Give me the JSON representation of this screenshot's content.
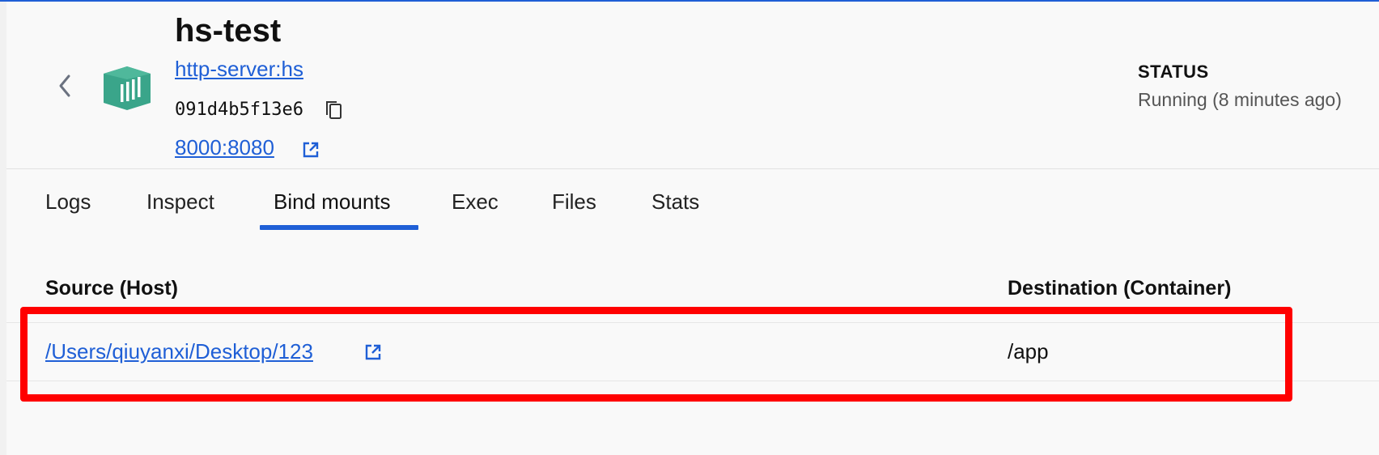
{
  "header": {
    "title": "hs-test",
    "image_link": "http-server:hs",
    "container_id": "091d4b5f13e6",
    "port_link": "8000:8080",
    "status_label": "STATUS",
    "status_value": "Running (8 minutes ago)"
  },
  "icons": {
    "back": "chevron-left-icon",
    "container": "container-icon",
    "copy": "copy-icon",
    "external": "external-link-icon"
  },
  "colors": {
    "accent": "#1f5fd6",
    "container_icon": "#3aa58a",
    "highlight": "#ff0000"
  },
  "tabs": [
    {
      "label": "Logs",
      "active": false
    },
    {
      "label": "Inspect",
      "active": false
    },
    {
      "label": "Bind mounts",
      "active": true
    },
    {
      "label": "Exec",
      "active": false
    },
    {
      "label": "Files",
      "active": false
    },
    {
      "label": "Stats",
      "active": false
    }
  ],
  "table": {
    "headers": [
      "Source (Host)",
      "Destination (Container)"
    ],
    "rows": [
      {
        "source": "/Users/qiuyanxi/Desktop/123",
        "destination": "/app"
      }
    ]
  }
}
